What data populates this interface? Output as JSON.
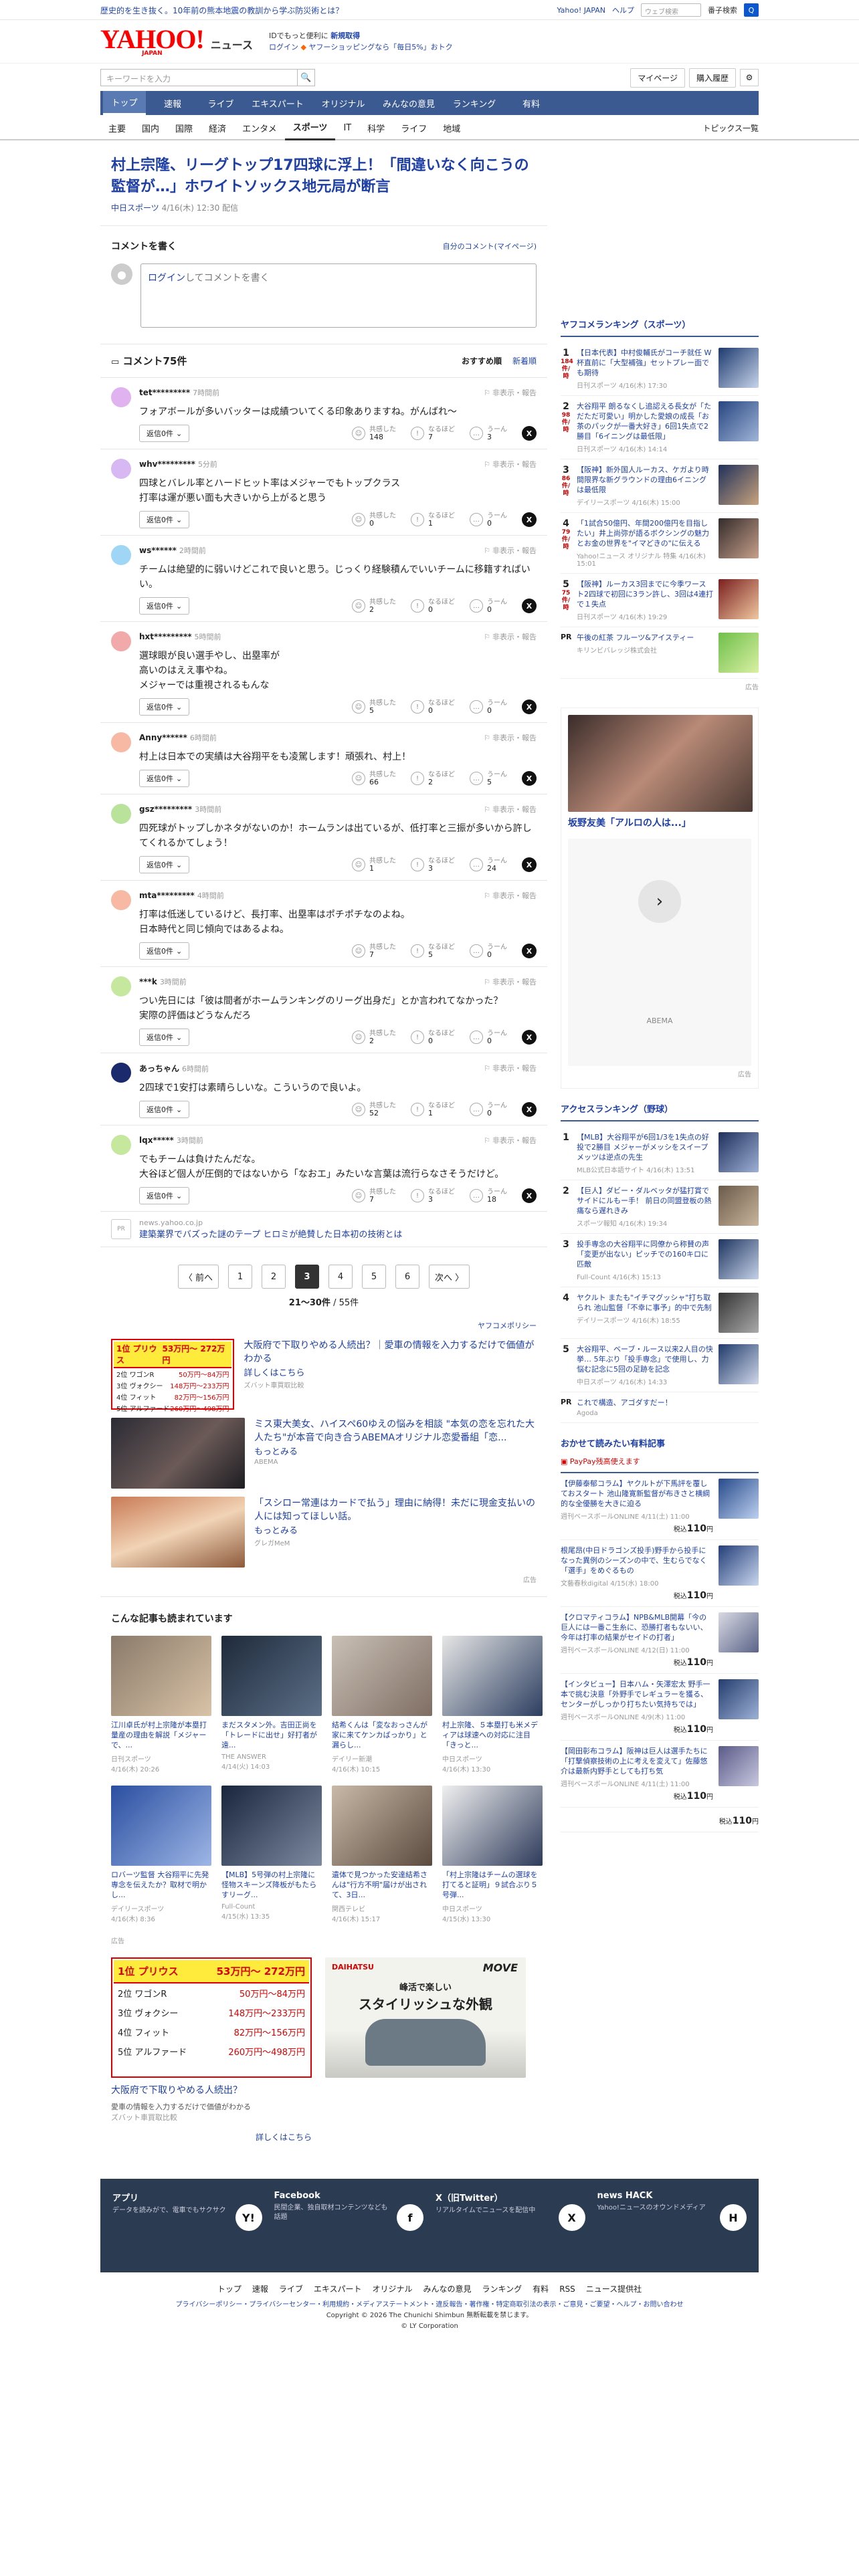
{
  "topbar": {
    "news": "歴史的を生き抜く。10年前の熊本地震の教訓から学ぶ防災術とは？",
    "links": [
      "Yahoo! JAPAN",
      "ヘルプ"
    ],
    "search_placeholder": "ウェブ検索",
    "mail_label": "番子検索",
    "mail_button": "Q"
  },
  "header": {
    "logo": "YAHOO!",
    "logo_sub": "JAPAN",
    "section": "ニュース",
    "promo_line1_a": "IDでもっと便利に",
    "promo_line1_b": "新規取得",
    "promo_line2_a": "ログイン",
    "promo_line2_b": "ヤフーショッピングなら「毎日5%」おトク"
  },
  "searchrow": {
    "placeholder": "キーワードを入力",
    "mypage": "マイページ",
    "history": "購入履歴"
  },
  "mainnav": [
    "トップ",
    "速報",
    "ライブ",
    "エキスパート",
    "オリジナル",
    "みんなの意見",
    "ランキング",
    "有料"
  ],
  "subnav": [
    "主要",
    "国内",
    "国際",
    "経済",
    "エンタメ",
    "スポーツ",
    "IT",
    "科学",
    "ライフ",
    "地域"
  ],
  "topics_list": "トピックス一覧",
  "article": {
    "title": "村上宗隆、リーグトップ17四球に浮上！「間違いなく向こうの監督が…」ホワイトソックス地元局が断言",
    "source": "中日スポーツ",
    "date": "4/16(木) 12:30 配信"
  },
  "compose": {
    "title": "コメントを書く",
    "mycomments": "自分のコメント(マイページ)",
    "login": "ログイン",
    "prompt": "してコメントを書く"
  },
  "comments_head": {
    "count": "コメント75件",
    "sort_recommended": "おすすめ順",
    "sort_new": "新着順"
  },
  "labels": {
    "reply": "返信0件",
    "hide": "非表示・報告",
    "react1": "共感した",
    "react2": "なるほど",
    "react3": "うーん"
  },
  "comments": [
    {
      "name": "tet*********",
      "time": "7時間前",
      "text": "フォアボールが多いバッターは成績ついてくる印象ありますね。がんばれ～",
      "c1": "148",
      "c2": "7",
      "c3": "3",
      "color": "#e0b3f0"
    },
    {
      "name": "whv*********",
      "time": "5分前",
      "text": "四球とバレル率とハードヒット率はメジャーでもトップクラス\n打率は運が悪い面も大きいから上がると思う",
      "c1": "0",
      "c2": "1",
      "c3": "0",
      "color": "#d7b8f2"
    },
    {
      "name": "ws******",
      "time": "2時間前",
      "text": "チームは絶望的に弱いけどこれで良いと思う。じっくり経験積んでいいチームに移籍すればいい。",
      "c1": "2",
      "c2": "0",
      "c3": "0",
      "color": "#9fd6f5"
    },
    {
      "name": "hxt*********",
      "time": "5時間前",
      "text": "選球眼が良い選手やし、出塁率が\n高いのはええ事やね。\nメジャーでは重視されるもんな",
      "c1": "5",
      "c2": "0",
      "c3": "0",
      "color": "#f2a9a9"
    },
    {
      "name": "Anny******",
      "time": "6時間前",
      "text": "村上は日本での実績は大谷翔平をも凌駕します！頑張れ、村上！",
      "c1": "66",
      "c2": "2",
      "c3": "5",
      "color": "#f7b9a3"
    },
    {
      "name": "gsz*********",
      "time": "3時間前",
      "text": "四死球がトップしかネタがないのか！ホームランは出ているが、低打率と三振が多いから許してくれるかてしょう！",
      "c1": "1",
      "c2": "3",
      "c3": "24",
      "color": "#b9e39b"
    },
    {
      "name": "mta*********",
      "time": "4時間前",
      "text": "打率は低迷しているけど、長打率、出塁率はポチポチなのよね。\n日本時代と同じ傾向ではあるよね。",
      "c1": "7",
      "c2": "5",
      "c3": "0",
      "color": "#f7b9a3"
    },
    {
      "name": "***k",
      "time": "3時間前",
      "text": "つい先日には「彼は間者がホームランキングのリーグ出身だ」とか言われてなかった？\n実際の評価はどうなんだろ",
      "c1": "2",
      "c2": "0",
      "c3": "0",
      "color": "#c5e89e"
    },
    {
      "name": "あっちゃん",
      "time": "6時間前",
      "text": "2四球で1安打は素晴らしいな。こういうので良いよ。",
      "c1": "52",
      "c2": "1",
      "c3": "0",
      "color": "#1a2a6c"
    },
    {
      "name": "lqx*****",
      "time": "3時間前",
      "text": "でもチームは負けたんだな。\n大谷ほど個人が圧倒的ではないから「なおエ」みたいな言葉は流行らなさそうだけど。",
      "c1": "7",
      "c2": "3",
      "c3": "18",
      "color": "#c5e89e"
    }
  ],
  "adline": {
    "pr": "PR",
    "src": "news.yahoo.co.jp",
    "title": "建築業界でバズった謎のテープ ヒロミが絶賛した日本初の技術とは"
  },
  "pager": {
    "prev": "〈 前へ",
    "pages": [
      "1",
      "2",
      "3",
      "4",
      "5",
      "6"
    ],
    "next": "次へ 〉",
    "info_range": "21～30件",
    "info_total": "/ 55件"
  },
  "ads_policy": "ヤフコメポリシー",
  "ad_flag": "広告",
  "ads": [
    {
      "title": "大阪府で下取りやめる人続出？｜愛車の情報を入力するだけで価値がわかる",
      "more": "詳しくはこちら",
      "sponsor": "ズバット車買取比較"
    },
    {
      "title": "ミス東大美女、ハイスペ60ゆえの悩みを相談 \"本気の恋を忘れた大人たち\"が本音で向き合うABEMAオリジナル恋愛番組「恋...",
      "more": "もっとみる",
      "sponsor": "ABEMA"
    },
    {
      "title": "「スシロー常連はカードで払う」理由に納得！未だに現金支払いの人には知ってほしい話。",
      "more": "もっとみる",
      "sponsor": "グレガMeM"
    }
  ],
  "rank_ad": {
    "title": "1位 プリウス",
    "title_price_a": "53万円～",
    "title_price_b": "272万円",
    "rows": [
      {
        "rank": "2位",
        "name": "ワゴンR",
        "price": "50万円～84万円"
      },
      {
        "rank": "3位",
        "name": "ヴォクシー",
        "price": "148万円～233万円"
      },
      {
        "rank": "4位",
        "name": "フィット",
        "price": "82万円～156万円"
      },
      {
        "rank": "5位",
        "name": "アルファード",
        "price": "260万円～498万円"
      }
    ]
  },
  "alsoread": {
    "heading": "こんな記事も読まれています",
    "cards": [
      {
        "title": "江川卓氏が村上宗隆が本塁打量産の理由を解説「メジャーで、...",
        "src": "日刊スポーツ",
        "date": "4/16(木) 20:26"
      },
      {
        "title": "まだスタメン外。吉田正尚を「トレードに出せ」好打者が遠...",
        "src": "THE ANSWER",
        "date": "4/14(火) 14:03"
      },
      {
        "title": "結希くんは「変なおっさんが家に来てケンカばっかり」と漏らし...",
        "src": "デイリー新潮",
        "date": "4/16(木) 10:15"
      },
      {
        "title": "村上宗隆、５本塁打も米メディアは球速への対応に注目「きっと...",
        "src": "中日スポーツ",
        "date": "4/16(木) 13:30"
      },
      {
        "title": "ロバーツ監督 大谷翔平に先発専念を伝えたか？取材で明かし...",
        "src": "デイリースポーツ",
        "date": "4/16(木) 8:36"
      },
      {
        "title": "【MLB】5号弾の村上宗隆に怪物スキーンズ降板がもたらすリーグ...",
        "src": "Full-Count",
        "date": "4/15(水) 13:35"
      },
      {
        "title": "遺体で見つかった安達結希さんは\"行方不明\"届けが出されて、3日...",
        "src": "関西テレビ",
        "date": "4/16(木) 15:17"
      },
      {
        "title": "「村上宗隆はチームの選球を打てると証明」９試合ぶり５号弾...",
        "src": "中日スポーツ",
        "date": "4/15(水) 13:30"
      }
    ]
  },
  "bottomads": [
    {
      "title": "大阪府で下取りやめる人続出？",
      "desc": "愛車の情報を入力するだけで価値がわかる",
      "sponsor": "ズバット車買取比較",
      "more": "詳しくはこちら"
    },
    {
      "brand": "DAIHATSU",
      "model": "MOVE",
      "headline": "峰活で楽しい",
      "sub": "スタイリッシュな外観"
    }
  ],
  "side_rank": {
    "title": "ヤフコメランキング（スポーツ）",
    "items": [
      {
        "no": "1",
        "mv": "184件/時",
        "title": "【日本代表】中村俊輔氏がコーチ就任 W杯直前に「大型補強」セットプレー面でも期待",
        "src": "日刊スポーツ 4/16(木) 17:30"
      },
      {
        "no": "2",
        "mv": "98件/時",
        "title": "大谷翔平 朗るなくし追認える長女が「ただただ可愛い」明かした愛娘の成長「お茶のパックが一番大好き」6回1失点で2勝目「6イニングは最低限」",
        "src": "日刊スポーツ 4/16(木) 14:14"
      },
      {
        "no": "3",
        "mv": "86件/時",
        "title": "【阪神】新外国人ルーカス、ケガより時間限界な新グラウンドの理由6イニングは最低限",
        "src": "デイリースポーツ 4/16(木) 15:00"
      },
      {
        "no": "4",
        "mv": "79件/時",
        "title": "「1試合50億円、年間200億円を目指したい」井上尚弥が語るボクシングの魅力とお金の世界を\"イマどきの\"に伝える",
        "src": "Yahoo!ニュース オリジナル 特集 4/16(木) 15:01"
      },
      {
        "no": "5",
        "mv": "75件/時",
        "title": "【阪神】ルーカス3回までに今季ワースト2四球で初回に3ラン許し、3回は4連打で１失点",
        "src": "日刊スポーツ 4/16(木) 19:29"
      }
    ],
    "pr_title": "午後の紅茶 フルーツ&アイスティー",
    "pr_src": "キリンビバレッジ株式会社"
  },
  "side_ad": {
    "title": "坂野友美「アルロの人は...」",
    "label": "ABEMA"
  },
  "side_access": {
    "title": "アクセスランキング（野球）",
    "items": [
      {
        "no": "1",
        "title": "【MLB】大谷翔平が6回1/3を1失点の好投で2勝目 メジャーがメッシをスイープ メッツは逆点の先生",
        "src": "MLB公式日本語サイト 4/16(木) 13:51"
      },
      {
        "no": "2",
        "title": "【巨人】ダビー・ダルベッタが猛打賞でサイドにルもー手！ 前日の同盟登板の熱痛なら遅れきみ",
        "src": "スポーツ報知 4/16(木) 19:34"
      },
      {
        "no": "3",
        "title": "投手専念の大谷翔平に同僚から称賛の声「変更が出ない」ピッチでの160キロに匹敵",
        "src": "Full-Count 4/16(木) 15:13"
      },
      {
        "no": "4",
        "title": "ヤクルト またも\"イチマグッシャ\"打ち取られ 池山監督「不幸に事予」的中で先制",
        "src": "デイリースポーツ 4/16(木) 18:55"
      },
      {
        "no": "5",
        "title": "大谷翔平、ベーブ・ルース以来2人目の快挙… 5年ぶり「投手専念」で使用し、力悩む記念に5回の足跡を記念",
        "src": "中日スポーツ 4/16(木) 14:33"
      }
    ],
    "pr_title": "これで構造、アゴダすだー！",
    "pr_src": "Agoda"
  },
  "side_bought": {
    "title": "おかせて読みたい有料記事",
    "paypay": "PayPay残高使えます",
    "items": [
      {
        "title": "【伊藤泰郁コラム】ヤクルトが下馬評を覆しておスタート 池山隆寛新監督が布きさと横綱的な全優勝を大きに迫る",
        "src": "週刊ベースボールONLINE 4/11(土) 11:00",
        "price": "110"
      },
      {
        "title": "根尾昂(中日ドラゴンズ投手)野手から投手になった異例のシーズンの中で、生むらでなく「選手」をめぐるもの",
        "src": "文藝春秋digital 4/15(水) 18:00",
        "price": "110"
      },
      {
        "title": "【クロマティコラム】NPB&MLB開幕「今の巨人には一番こ生糸に、恐勝打者もないい、今年は打率の結果がセイドの打者」",
        "src": "週刊ベースボールONLINE 4/12(日) 11:00",
        "price": "110"
      },
      {
        "title": "【インタビュー】日本ハム・矢澤宏太 野手一本で挑む決意「外野手でレギュラーを獲る、センターがしっかり打ちたい気持ちでは」",
        "src": "週刊ベースボールONLINE 4/9(木) 11:00",
        "price": "110"
      },
      {
        "title": "【岡田彰布コラム】阪神は巨人は選手たちに「打撃偵察技術の上に考えを変えて」佐藤悠介は最新内野手としても打ち気",
        "src": "週刊ベースボールONLINE 4/11(土) 11:00",
        "price": "110"
      },
      {
        "title": "",
        "src": "",
        "price": "110"
      }
    ],
    "price_prefix": "税込",
    "price_suffix": "円"
  },
  "footer": {
    "items": [
      {
        "t": "アプリ",
        "d": "データを読みがで、電車でもサクサク",
        "ic": "Y!"
      },
      {
        "t": "Facebook",
        "d": "民間企業、独自取材コンテンツなども話題",
        "ic": "f"
      },
      {
        "t": "X（旧Twitter）",
        "d": "リアルタイムでニュースを配信中",
        "ic": "X"
      },
      {
        "t": "news HACK",
        "d": "Yahoo!ニュースのオウンドメディア",
        "ic": "H"
      }
    ],
    "nav": [
      "トップ",
      "速報",
      "ライブ",
      "エキスパート",
      "オリジナル",
      "みんなの意見",
      "ランキング",
      "有料",
      "RSS",
      "ニュース提供社"
    ],
    "legal": "プライバシーポリシー・プライバシーセンター・利用規約・メディアステートメント・違反報告・著作権・特定商取引法の表示・ご意見・ご要望・ヘルプ・お問い合わせ",
    "copyright1": "Copyright © 2026 The Chunichi Shimbun 無断転載を禁じます。",
    "copyright2": "© LY Corporation"
  }
}
